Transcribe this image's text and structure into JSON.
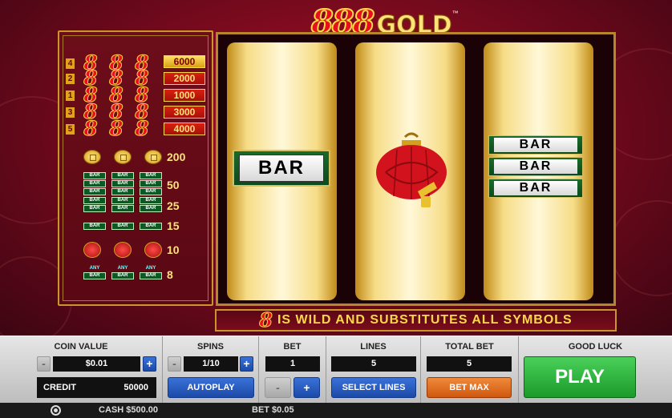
{
  "logo": {
    "digits": "888",
    "word": "GOLD",
    "tm": "™"
  },
  "paytable": {
    "lines": [
      {
        "num": "4",
        "value": "6000",
        "highlight": true
      },
      {
        "num": "2",
        "value": "2000",
        "highlight": false
      },
      {
        "num": "1",
        "value": "1000",
        "highlight": false
      },
      {
        "num": "3",
        "value": "3000",
        "highlight": false
      },
      {
        "num": "5",
        "value": "4000",
        "highlight": false
      }
    ],
    "eight_glyph": "8",
    "symbol_pays": [
      {
        "symbol": "coins",
        "pay": "200"
      },
      {
        "symbol": "triple-bar",
        "pay": "50"
      },
      {
        "symbol": "double-bar",
        "pay": "25"
      },
      {
        "symbol": "single-bar",
        "pay": "15"
      },
      {
        "symbol": "lantern",
        "pay": "10"
      },
      {
        "symbol": "any-bar",
        "pay": "8"
      }
    ],
    "bar_text": "BAR",
    "any_text": "ANY"
  },
  "reels": {
    "reel1": {
      "symbol": "BAR"
    },
    "reel2": {
      "symbol": "lantern"
    },
    "reel3": {
      "symbol": [
        "BAR",
        "BAR",
        "BAR"
      ]
    }
  },
  "banner": {
    "glyph": "8",
    "text": "IS WILD AND SUBSTITUTES ALL SYMBOLS"
  },
  "controls": {
    "coin_value": {
      "label": "COIN VALUE",
      "value": "$0.01",
      "minus": "-",
      "plus": "+"
    },
    "credit": {
      "label": "CREDIT",
      "value": "50000"
    },
    "spins": {
      "label": "SPINS",
      "value": "1/10",
      "minus": "-",
      "plus": "+",
      "autoplay": "AUTOPLAY"
    },
    "bet": {
      "label": "BET",
      "value": "1",
      "minus": "-",
      "plus": "+"
    },
    "lines": {
      "label": "LINES",
      "value": "5",
      "select": "SELECT LINES"
    },
    "total_bet": {
      "label": "TOTAL BET",
      "value": "5",
      "bet_max": "BET MAX"
    },
    "good_luck": {
      "label": "GOOD LUCK",
      "play": "PLAY"
    }
  },
  "status": {
    "cash": "CASH $500.00",
    "bet": "BET $0.05"
  },
  "colors": {
    "reel_gold": "#f6dc86",
    "panel_blue": "#1b4aa8",
    "play_green": "#1a9a2a",
    "bet_max_orange": "#d0580e"
  }
}
